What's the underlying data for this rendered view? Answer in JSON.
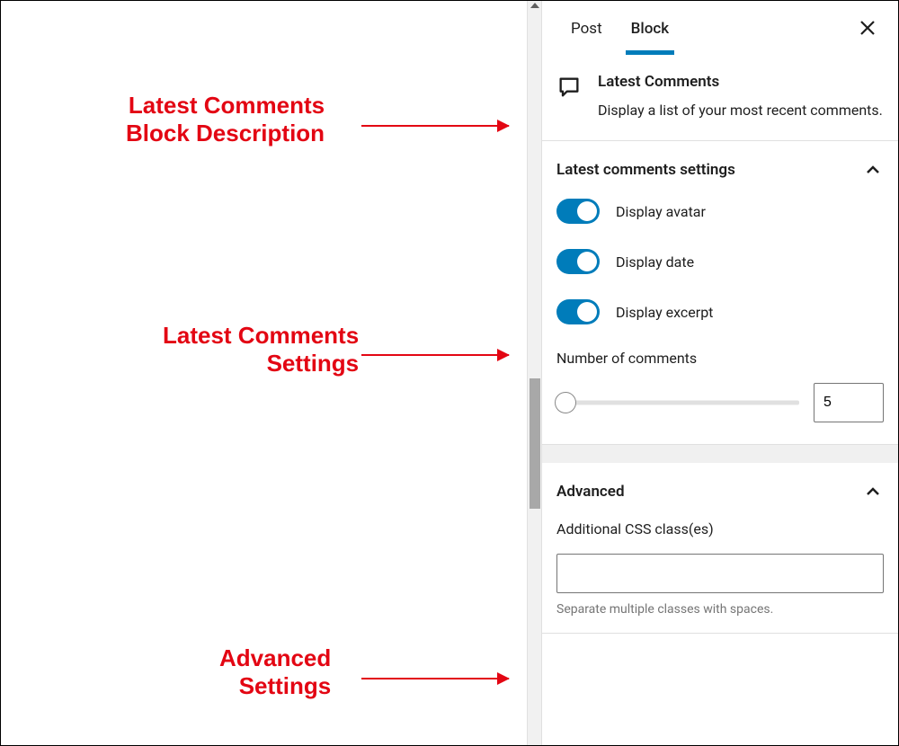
{
  "annotations": {
    "desc_line1": "Latest Comments",
    "desc_line2": "Block Description",
    "settings_line1": "Latest Comments",
    "settings_line2": "Settings",
    "advanced_line1": "Advanced",
    "advanced_line2": "Settings"
  },
  "tabs": {
    "post": "Post",
    "block": "Block"
  },
  "block": {
    "title": "Latest Comments",
    "description": "Display a list of your most recent comments."
  },
  "settings": {
    "panel_title": "Latest comments settings",
    "toggles": {
      "avatar": "Display avatar",
      "date": "Display date",
      "excerpt": "Display excerpt"
    },
    "number_label": "Number of comments",
    "number_value": "5"
  },
  "advanced": {
    "panel_title": "Advanced",
    "css_label": "Additional CSS class(es)",
    "css_value": "",
    "help_text": "Separate multiple classes with spaces."
  }
}
